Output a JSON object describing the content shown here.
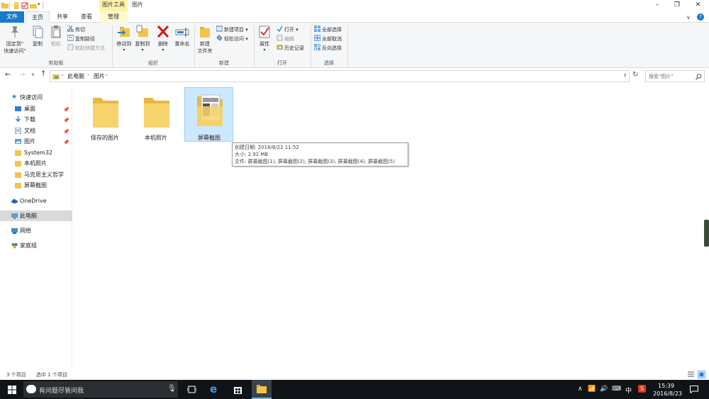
{
  "titlebar": {
    "contextual_tab": "图片工具",
    "window_title": "图片",
    "minimize": "–",
    "maximize": "❐",
    "close": "✕"
  },
  "tabs": {
    "file": "文件",
    "home": "主页",
    "share": "共享",
    "view": "查看",
    "manage": "管理"
  },
  "ribbon": {
    "clipboard": {
      "label": "剪贴板",
      "pin": "固定到\"\n快速访问\"",
      "pin_1": "固定到\"",
      "pin_2": "快速访问\"",
      "copy": "复制",
      "paste": "粘贴",
      "cut": "剪切",
      "copy_path": "复制路径",
      "paste_shortcut": "粘贴快捷方式"
    },
    "organize": {
      "label": "组织",
      "move_to": "移动到",
      "copy_to": "复制到",
      "delete": "删除",
      "rename": "重命名"
    },
    "new": {
      "label": "新建",
      "new_folder_1": "新建",
      "new_folder_2": "文件夹",
      "new_item": "新建项目",
      "easy_access": "轻松访问"
    },
    "open": {
      "label": "打开",
      "properties": "属性",
      "open": "打开",
      "edit": "编辑",
      "history": "历史记录"
    },
    "select": {
      "label": "选择",
      "select_all": "全部选择",
      "select_none": "全部取消",
      "invert": "反向选择"
    }
  },
  "address": {
    "crumb_pc": "此电脑",
    "crumb_pictures": "图片",
    "search_placeholder": "搜索\"图片\""
  },
  "nav": {
    "quick_access": "快速访问",
    "items": [
      {
        "label": "桌面"
      },
      {
        "label": "下载"
      },
      {
        "label": "文档"
      },
      {
        "label": "图片"
      },
      {
        "label": "System32"
      },
      {
        "label": "本机照片"
      },
      {
        "label": "马克思主义哲学"
      },
      {
        "label": "屏幕截图"
      }
    ],
    "onedrive": "OneDrive",
    "this_pc": "此电脑",
    "network": "网络",
    "homegroup": "家庭组"
  },
  "files": [
    {
      "name": "保存的图片"
    },
    {
      "name": "本机照片"
    },
    {
      "name": "屏幕截图"
    }
  ],
  "tooltip": {
    "line1": "创建日期: 2016/8/22 11:52",
    "line2": "大小: 2.92 MB",
    "line3": "文件: 屏幕截图(1), 屏幕截图(2), 屏幕截图(3), 屏幕截图(4), 屏幕截图(5)"
  },
  "status": {
    "count": "3 个项目",
    "selected": "选中 1 个项目"
  },
  "taskbar": {
    "search": "有问题尽管问我",
    "ime": "中",
    "time": "15:39",
    "date": "2016/8/23"
  },
  "colors": {
    "accent": "#1979ca",
    "contextual": "#fff2a8",
    "folder": "#f7d36b",
    "selection": "#cce8ff",
    "taskbar": "#101418"
  }
}
